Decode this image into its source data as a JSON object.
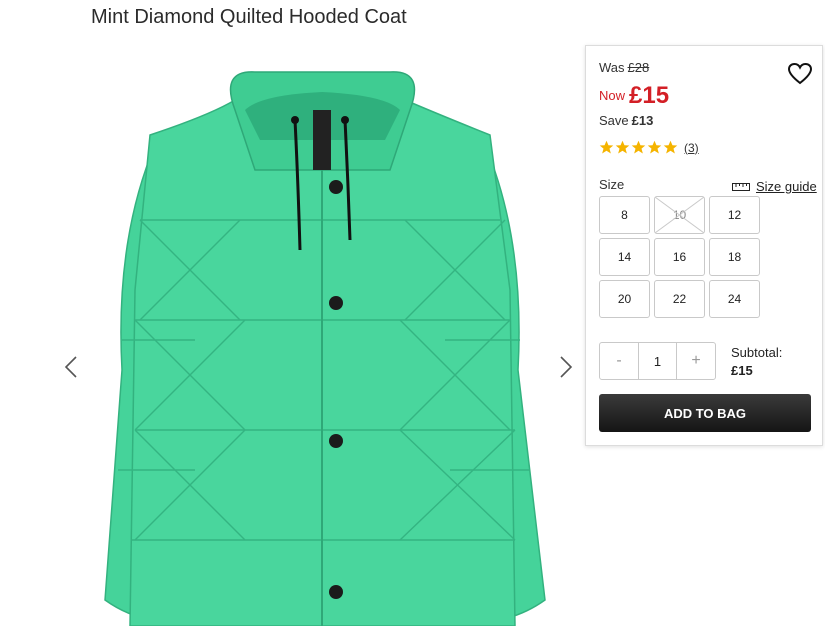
{
  "product": {
    "title": "Mint Diamond Quilted Hooded Coat",
    "image_alt": "Mint green quilted puffer coat with hood",
    "colors": {
      "coat": "#45d39a",
      "coat_shade": "#33b27f",
      "coat_light": "#5ee0ab",
      "accent": "#d31f26",
      "button": "#1b1b1b"
    }
  },
  "price": {
    "was_label": "Was",
    "was_value": "£28",
    "now_label": "Now",
    "now_value": "£15",
    "save_label": "Save",
    "save_value": "£13"
  },
  "rating": {
    "stars": 5,
    "count": "(3)"
  },
  "size": {
    "label": "Size",
    "guide_label": "Size guide",
    "options": [
      {
        "label": "8",
        "available": true
      },
      {
        "label": "10",
        "available": false
      },
      {
        "label": "12",
        "available": true
      },
      {
        "label": "14",
        "available": true
      },
      {
        "label": "16",
        "available": true
      },
      {
        "label": "18",
        "available": true
      },
      {
        "label": "20",
        "available": true
      },
      {
        "label": "22",
        "available": true
      },
      {
        "label": "24",
        "available": true
      }
    ]
  },
  "quantity": {
    "minus": "-",
    "value": "1",
    "plus": "+"
  },
  "subtotal": {
    "label": "Subtotal:",
    "value": "£15"
  },
  "cart": {
    "add_label": "ADD TO BAG"
  }
}
